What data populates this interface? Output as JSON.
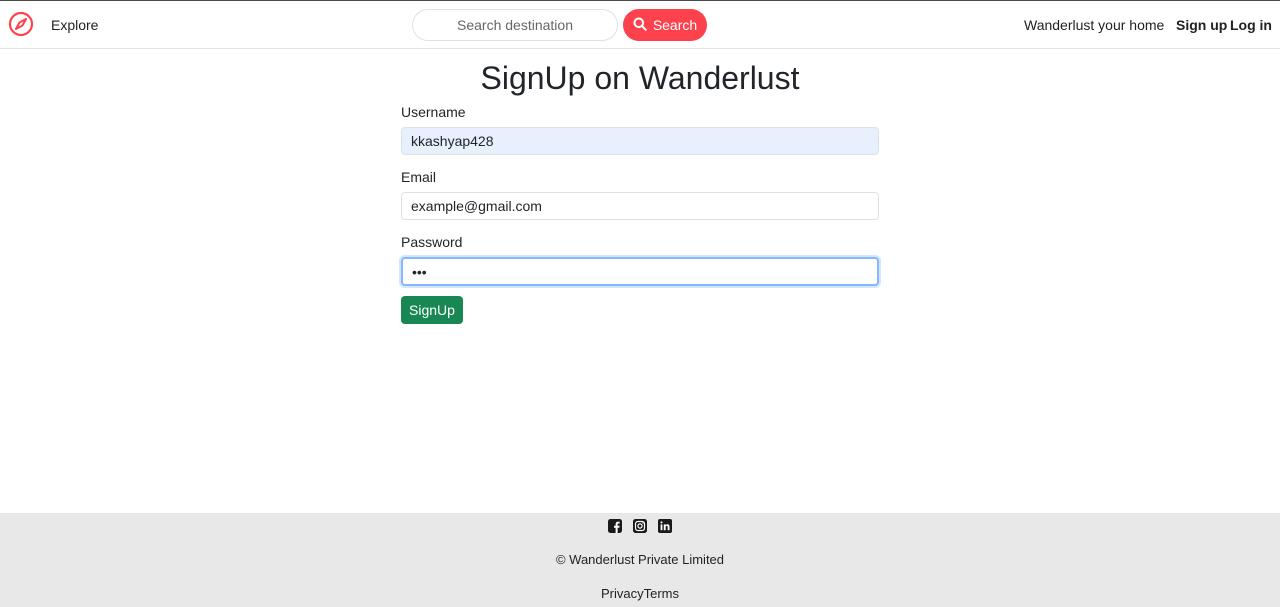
{
  "navbar": {
    "explore_label": "Explore",
    "search": {
      "placeholder": "Search destination",
      "button_label": "Search"
    },
    "home_label": "Wanderlust your home",
    "signup_label": "Sign up",
    "login_label": "Log in"
  },
  "page": {
    "title": "SignUp on Wanderlust"
  },
  "form": {
    "username": {
      "label": "Username",
      "value": "kkashyap428"
    },
    "email": {
      "label": "Email",
      "value": "example@gmail.com"
    },
    "password": {
      "label": "Password",
      "value": "•••"
    },
    "submit_label": "SignUp"
  },
  "footer": {
    "socials": [
      "facebook-icon",
      "instagram-icon",
      "linkedin-icon"
    ],
    "copyright": "© Wanderlust Private Limited",
    "privacy_label": "Privacy",
    "terms_label": "Terms"
  },
  "colors": {
    "brand": "#fe424d",
    "submit": "#198754",
    "footer_bg": "#e8e8e8"
  }
}
